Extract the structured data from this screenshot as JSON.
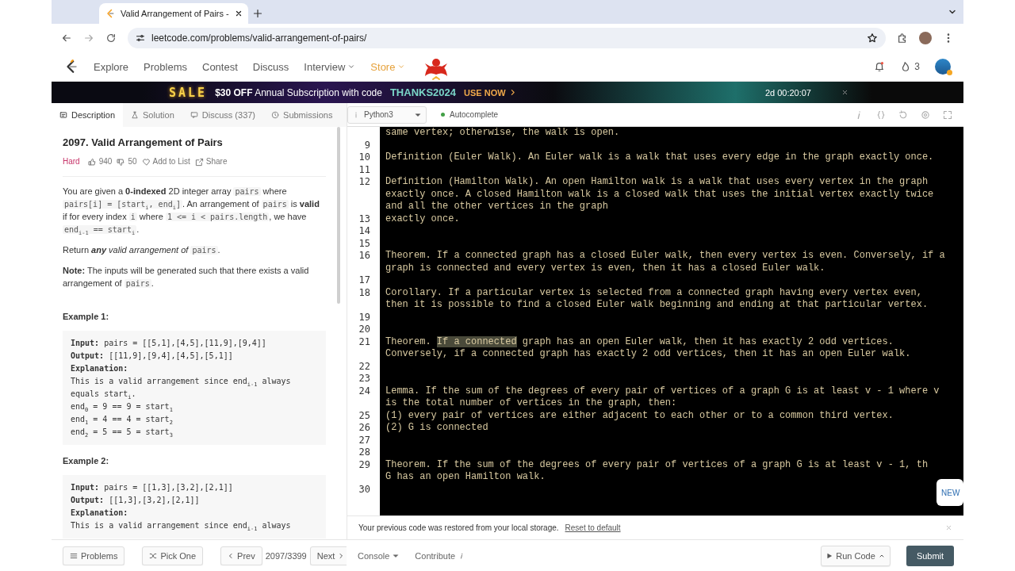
{
  "browser": {
    "tab_title": "Valid Arrangement of Pairs - ",
    "url": "leetcode.com/problems/valid-arrangement-of-pairs/"
  },
  "nav": {
    "items": [
      {
        "label": "Explore",
        "kind": "link"
      },
      {
        "label": "Problems",
        "kind": "link"
      },
      {
        "label": "Contest",
        "kind": "link"
      },
      {
        "label": "Discuss",
        "kind": "link"
      },
      {
        "label": "Interview",
        "kind": "menu"
      },
      {
        "label": "Store",
        "kind": "store"
      }
    ],
    "streak": "3"
  },
  "banner": {
    "sale": "SALE",
    "offer": "$30 OFF",
    "text": "Annual Subscription with code",
    "code": "THANKS2024",
    "cta": "USE NOW",
    "countdown": "2d 00:20:07"
  },
  "tabs": [
    {
      "label": "Description",
      "selected": true
    },
    {
      "label": "Solution",
      "selected": false
    },
    {
      "label": "Discuss (337)",
      "selected": false
    },
    {
      "label": "Submissions",
      "selected": false
    }
  ],
  "problem": {
    "title": "2097. Valid Arrangement of Pairs",
    "difficulty": "Hard",
    "likes": "940",
    "dislikes": "50",
    "add_to_list": "Add to List",
    "share": "Share",
    "paragraphs": [
      [
        {
          "kind": "text",
          "text": "You are given a "
        },
        {
          "kind": "bold",
          "text": "0-indexed"
        },
        {
          "kind": "text",
          "text": " 2D integer array "
        },
        {
          "kind": "code",
          "text": "pairs"
        },
        {
          "kind": "text",
          "text": " where "
        },
        {
          "kind": "code",
          "text": "pairs[i] = [start$_{i}$, end$_{i}$]"
        },
        {
          "kind": "text",
          "text": ". An arrangement of "
        },
        {
          "kind": "code",
          "text": "pairs"
        },
        {
          "kind": "text",
          "text": " is "
        },
        {
          "kind": "bold",
          "text": "valid"
        },
        {
          "kind": "text",
          "text": " if for every index "
        },
        {
          "kind": "code",
          "text": "i"
        },
        {
          "kind": "text",
          "text": " where "
        },
        {
          "kind": "code",
          "text": "1 <= i < pairs.length"
        },
        {
          "kind": "text",
          "text": ", we have "
        },
        {
          "kind": "code",
          "text": "end$_{i-1}$ == start$_{i}$"
        },
        {
          "kind": "text",
          "text": "."
        }
      ],
      [
        {
          "kind": "text",
          "text": "Return "
        },
        {
          "kind": "bold_italic",
          "text": "any"
        },
        {
          "kind": "italic",
          "text": " valid arrangement of "
        },
        {
          "kind": "code",
          "text": "pairs"
        },
        {
          "kind": "text",
          "text": "."
        }
      ],
      [
        {
          "kind": "bold",
          "text": "Note:"
        },
        {
          "kind": "text",
          "text": " The inputs will be generated such that there exists a valid arrangement of "
        },
        {
          "kind": "code",
          "text": "pairs"
        },
        {
          "kind": "text",
          "text": "."
        }
      ]
    ],
    "examples": [
      {
        "title": "Example 1:",
        "lines": [
          {
            "label": "Input:",
            "text": "pairs = [[5,1],[4,5],[11,9],[9,4]]"
          },
          {
            "label": "Output:",
            "text": "[[11,9],[9,4],[4,5],[5,1]]"
          },
          {
            "label": "Explanation:"
          },
          {
            "text": "This is a valid arrangement since end$_{i-1}$ always"
          },
          {
            "text": "equals start$_{i}$."
          },
          {
            "text": "end$_{0}$ = 9 == 9 = start$_{1}$"
          },
          {
            "text": "end$_{1}$ = 4 == 4 = start$_{2}$"
          },
          {
            "text": "end$_{2}$ = 5 == 5 = start$_{3}$"
          }
        ]
      },
      {
        "title": "Example 2:",
        "lines": [
          {
            "label": "Input:",
            "text": "pairs = [[1,3],[3,2],[2,1]]"
          },
          {
            "label": "Output:",
            "text": "[[1,3],[3,2],[2,1]]"
          },
          {
            "label": "Explanation:"
          },
          {
            "text": "This is a valid arrangement since end$_{i-1}$ always"
          }
        ]
      }
    ]
  },
  "editor": {
    "language": "Python3",
    "autocomplete": {
      "label": "Autocomplete",
      "on": true
    },
    "lines": [
      {
        "rows": [
          "same vertex; otherwise, the walk is open."
        ]
      },
      {
        "number": "9"
      },
      {
        "number": "10",
        "rows": [
          "Definition (Euler Walk). An Euler walk is a walk that uses every edge in the graph exactly once."
        ]
      },
      {
        "number": "11"
      },
      {
        "number": "12",
        "rows": [
          "Definition (Hamilton Walk). An open Hamilton walk is a walk that uses every vertex in the graph",
          "exactly once. A closed Hamilton walk is a closed walk that uses the initial vertex exactly twice",
          "and all the other vertices in the graph"
        ]
      },
      {
        "number": "13",
        "rows": [
          "exactly once."
        ]
      },
      {
        "number": "14"
      },
      {
        "number": "15"
      },
      {
        "number": "16",
        "rows": [
          "Theorem. If a connected graph has a closed Euler walk, then every vertex is even. Conversely, if a",
          "graph is connected and every vertex is even, then it has a closed Euler walk."
        ]
      },
      {
        "number": "17"
      },
      {
        "number": "18",
        "rows": [
          "Corollary. If a particular vertex is selected from a connected graph having every vertex even,",
          "then it is possible to find a closed Euler walk beginning and ending at that particular vertex."
        ]
      },
      {
        "number": "19"
      },
      {
        "number": "20"
      },
      {
        "number": "21",
        "rows": [
          [
            {
              "text": "Theorem. ",
              "highlighted": false
            },
            {
              "text": "If a connected",
              "highlighted": true
            },
            {
              "text": " graph has an open Euler walk, then it has exactly 2 odd vertices.",
              "highlighted": false
            }
          ],
          "Conversely, if a connected graph has exactly 2 odd vertices, then it has an open Euler walk."
        ]
      },
      {
        "number": "22"
      },
      {
        "number": "23"
      },
      {
        "number": "24",
        "rows": [
          "Lemma. If the sum of the degrees of every pair of vertices of a graph G is at least v - 1 where v",
          "is the total number of vertices in the graph, then:"
        ]
      },
      {
        "number": "25",
        "rows": [
          "(1) every pair of vertices are either adjacent to each other or to a common third vertex."
        ]
      },
      {
        "number": "26",
        "rows": [
          "(2) G is connected"
        ]
      },
      {
        "number": "27"
      },
      {
        "number": "28"
      },
      {
        "number": "29",
        "rows": [
          "Theorem. If the sum of the degrees of every pair of vertices of a graph G is at least v - 1, th",
          "G has an open Hamilton walk."
        ]
      },
      {
        "number": "30"
      }
    ],
    "new_badge": "NEW"
  },
  "notice": {
    "text": "Your previous code was restored from your local storage.",
    "link": "Reset to default"
  },
  "footer": {
    "problems": "Problems",
    "pick_one": "Pick One",
    "prev": "Prev",
    "position": "2097/3399",
    "next": "Next",
    "console": "Console",
    "contribute": "Contribute",
    "run": "Run Code",
    "submit": "Submit"
  }
}
